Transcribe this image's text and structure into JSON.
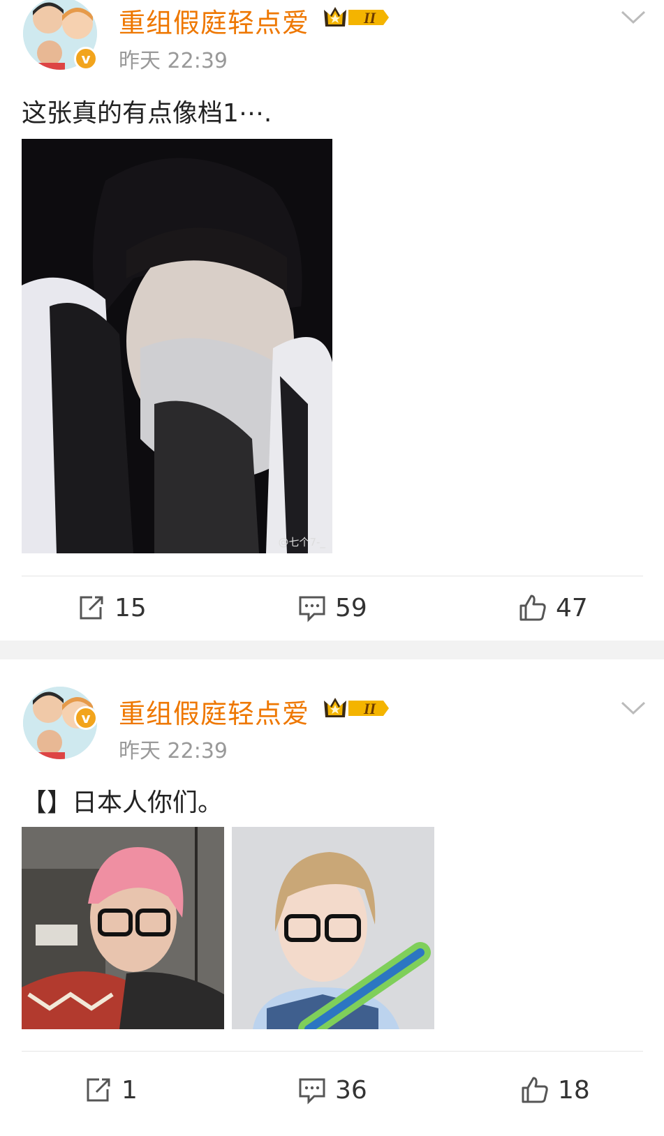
{
  "posts": [
    {
      "username": "重组假庭轻点爱",
      "vip_level": "II",
      "timestamp": "昨天 22:39",
      "text": "这张真的有点像档1⋯.",
      "watermark": "@七个7-_",
      "actions": {
        "reposts": "15",
        "comments": "59",
        "likes": "47"
      }
    },
    {
      "username": "重组假庭轻点爱",
      "vip_level": "II",
      "timestamp": "昨天 22:39",
      "text": "【】日本人你们。",
      "actions": {
        "reposts": "1",
        "comments": "36",
        "likes": "18"
      }
    }
  ],
  "colors": {
    "username": "#ee7700",
    "vip_gold": "#f4b400",
    "verified": "#f2a41c",
    "meta": "#999999"
  },
  "icons": [
    "chevron-down-icon",
    "repost-icon",
    "comment-icon",
    "like-icon",
    "verified-icon",
    "vip-crown-icon"
  ]
}
